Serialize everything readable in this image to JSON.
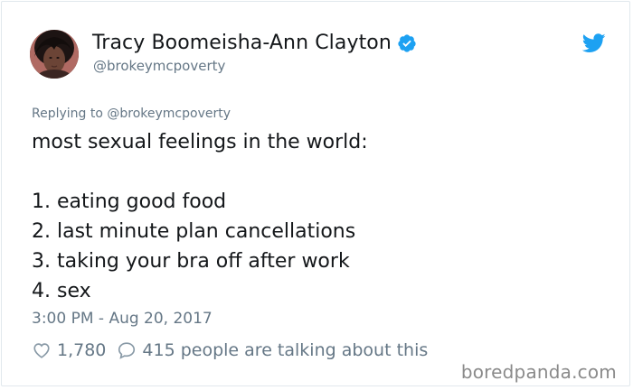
{
  "tweet": {
    "author": {
      "name": "Tracy Boomeisha-Ann Clayton",
      "handle": "@brokeymcpoverty",
      "verified": true
    },
    "replying": {
      "prefix": "Replying to ",
      "mention": "@brokeymcpoverty"
    },
    "body_lines": [
      "most sexual feelings in the world:",
      "",
      "1. eating good food",
      "2. last minute plan cancellations",
      "3. taking your bra off after work",
      "4. sex"
    ],
    "timestamp": "3:00 PM - Aug 20, 2017",
    "likes": "1,780",
    "talking": "415 people are talking about this"
  },
  "watermark": "boredpanda.com",
  "colors": {
    "twitter_blue": "#1da1f2",
    "muted_text": "#657786",
    "primary_text": "#14171a",
    "border": "#e1e8ed"
  },
  "icons": {
    "brand": "twitter-bird-icon",
    "verified": "verified-badge-icon",
    "like": "heart-icon",
    "reply": "speech-bubble-icon"
  }
}
